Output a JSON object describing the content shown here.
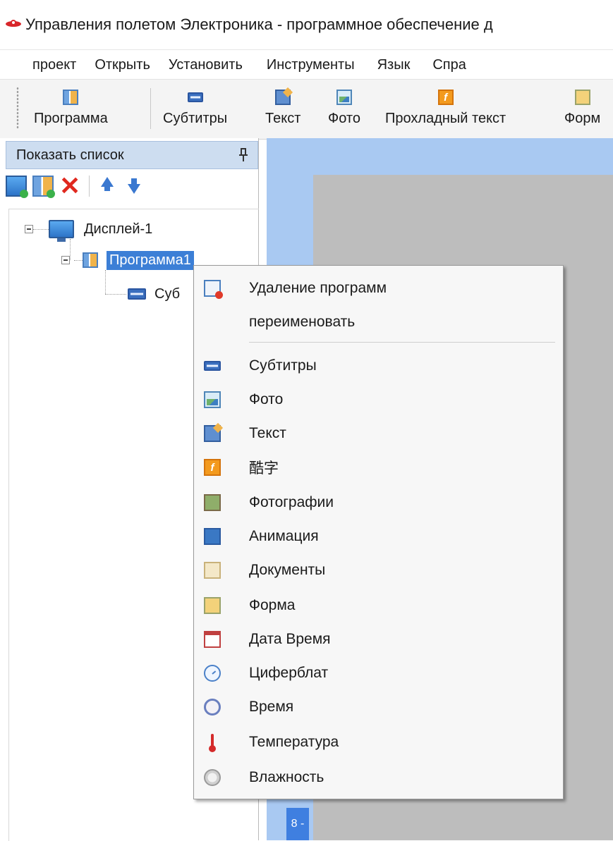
{
  "window": {
    "title": "Управления полетом Электроника - программное обеспечение д"
  },
  "menubar": {
    "items": [
      "проект",
      "Открыть",
      "Установить",
      "Инструменты",
      "Язык",
      "Спра"
    ]
  },
  "toolbar": {
    "buttons": [
      {
        "label": "Программа",
        "icon": "program-icon"
      },
      {
        "label": "Субтитры",
        "icon": "subtitles-icon"
      },
      {
        "label": "Текст",
        "icon": "text-icon"
      },
      {
        "label": "Фото",
        "icon": "photo-icon"
      },
      {
        "label": "Прохладный текст",
        "icon": "cool-text-icon"
      },
      {
        "label": "Форм",
        "icon": "form-icon"
      }
    ]
  },
  "list_panel": {
    "title": "Показать список",
    "tree": {
      "display": "Дисплей-1",
      "program": "Программа1",
      "subtitle": "Суб"
    }
  },
  "canvas": {
    "ruler_label": "8 -"
  },
  "context_menu": {
    "items": [
      {
        "label": "Удаление программ",
        "icon": "delete-program-icon"
      },
      {
        "label": "переименовать",
        "icon": ""
      },
      {
        "label": "Субтитры",
        "icon": "subtitles-icon"
      },
      {
        "label": "Фото",
        "icon": "photo-icon"
      },
      {
        "label": "Текст",
        "icon": "text-icon"
      },
      {
        "label": "酷字",
        "icon": "cool-text-icon"
      },
      {
        "label": "Фотографии",
        "icon": "picture-icon"
      },
      {
        "label": "Анимация",
        "icon": "animation-icon"
      },
      {
        "label": "Документы",
        "icon": "document-icon"
      },
      {
        "label": "Форма",
        "icon": "form-icon"
      },
      {
        "label": "Дата Время",
        "icon": "calendar-icon"
      },
      {
        "label": "Циферблат",
        "icon": "clock-dial-icon"
      },
      {
        "label": "Время",
        "icon": "time-icon"
      },
      {
        "label": "Температура",
        "icon": "thermometer-icon"
      },
      {
        "label": "Влажность",
        "icon": "humidity-icon"
      }
    ]
  },
  "colors": {
    "selection": "#3c7fd6",
    "panel_header": "#cdddf0",
    "canvas_blue": "#a9c9f2",
    "canvas_gray": "#bdbdbd",
    "delete_red": "#e0281e"
  }
}
